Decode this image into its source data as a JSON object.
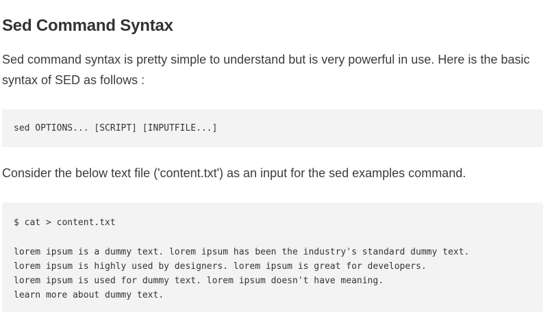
{
  "heading": "Sed Command Syntax",
  "intro": "Sed command syntax is pretty simple to understand but is very powerful in use. Here is the basic syntax of SED as follows :",
  "syntax_code": "sed OPTIONS... [SCRIPT] [INPUTFILE...]",
  "consider_text": "Consider the below text file ('content.txt') as an input for the sed examples command.",
  "example": {
    "command": "$ cat > content.txt",
    "lines": [
      "lorem ipsum is a dummy text. lorem ipsum has been the industry's standard dummy text.",
      "lorem ipsum is highly used by designers. lorem ipsum is great for developers.",
      "lorem ipsum is used for dummy text. lorem ipsum doesn't have meaning.",
      "learn more about dummy text."
    ]
  }
}
